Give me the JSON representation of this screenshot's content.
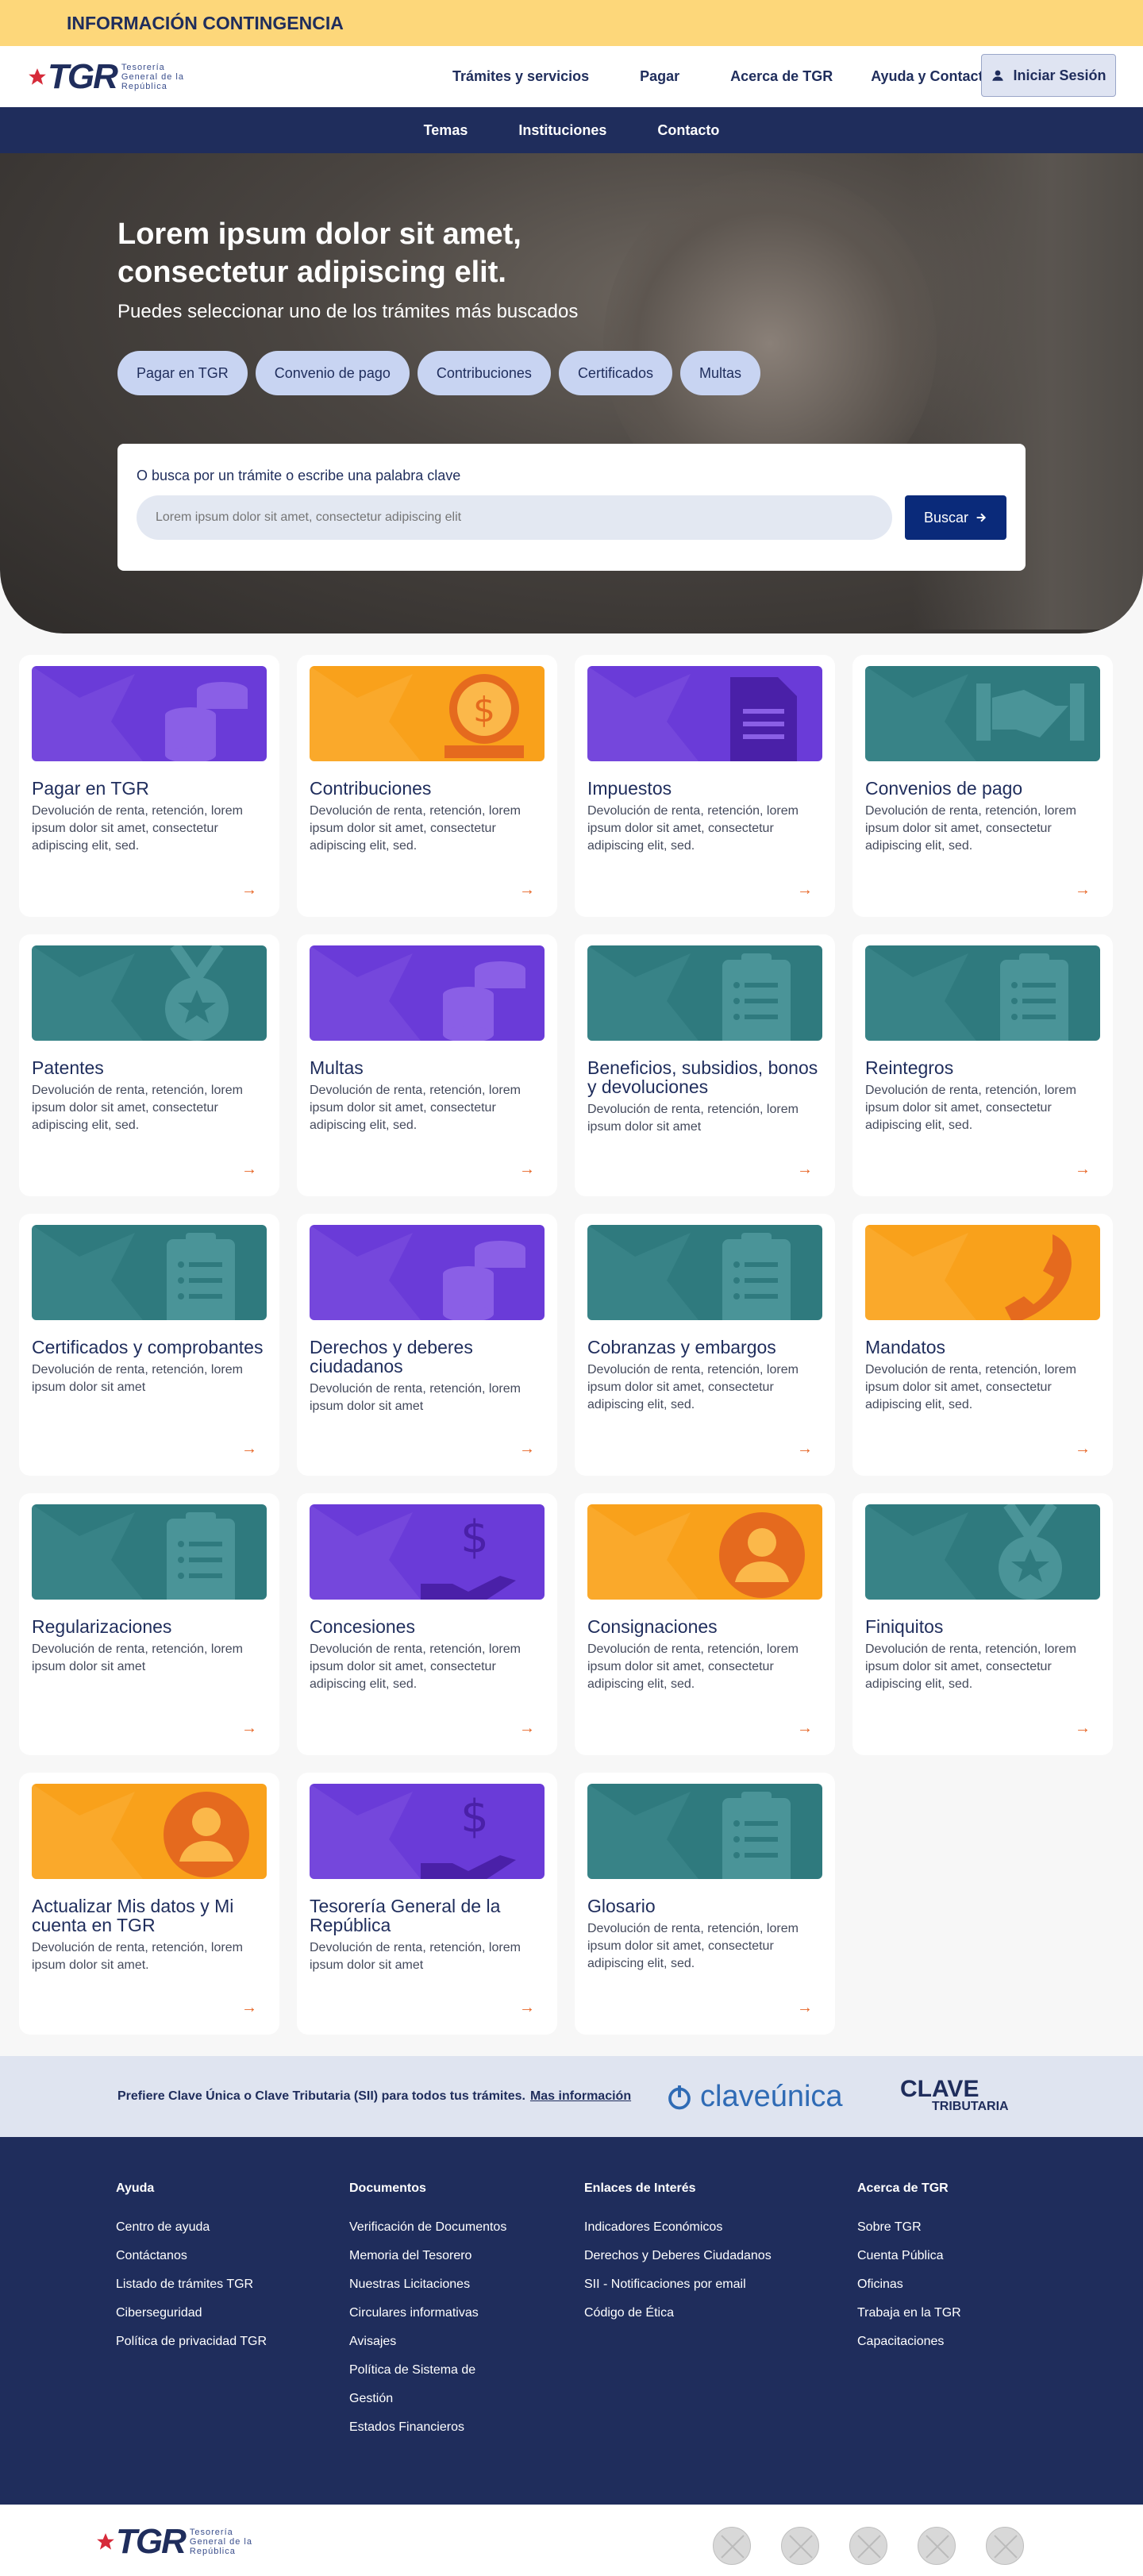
{
  "banner": {
    "text": "INFORMACIÓN CONTINGENCIA"
  },
  "header": {
    "logo_text": "TGR",
    "logo_sub": [
      "Tesorería",
      "General de la",
      "República"
    ],
    "nav": [
      "Trámites y servicios",
      "Pagar",
      "Acerca de TGR",
      "Ayuda y Contacto"
    ],
    "login_label": "Iniciar Sesión"
  },
  "subnav": [
    "Temas",
    "Instituciones",
    "Contacto"
  ],
  "hero": {
    "title": "Lorem ipsum dolor sit amet, consectetur adipiscing elit.",
    "subtitle": "Puedes seleccionar uno de los trámites más buscados",
    "chips": [
      "Pagar en TGR",
      "Convenio de pago",
      "Contribuciones",
      "Certificados",
      "Multas"
    ],
    "search_label": "O busca por un trámite o escribe una  palabra clave",
    "search_placeholder": "Lorem ipsum dolor sit amet, consectetur adipiscing elit",
    "search_button": "Buscar"
  },
  "cards": [
    {
      "title": "Pagar en TGR",
      "desc": "Devolución de renta, retención, lorem ipsum dolor sit amet, consectetur adipiscing elit, sed.",
      "color": "#6a3bd8",
      "icon": "coins-icon"
    },
    {
      "title": "Contribuciones",
      "desc": "Devolución de renta, retención, lorem ipsum dolor sit amet, consectetur adipiscing elit, sed.",
      "color": "#f9a11b",
      "icon": "dollar-coin-icon"
    },
    {
      "title": "Impuestos",
      "desc": "Devolución de renta, retención, lorem ipsum dolor sit amet, consectetur adipiscing elit, sed.",
      "color": "#6a3bd8",
      "icon": "document-icon"
    },
    {
      "title": "Convenios de pago",
      "desc": "Devolución de renta, retención, lorem ipsum dolor sit amet, consectetur adipiscing elit, sed.",
      "color": "#2f7a7e",
      "icon": "handshake-icon"
    },
    {
      "title": "Patentes",
      "desc": "Devolución de renta, retención, lorem ipsum dolor sit amet, consectetur adipiscing elit, sed.",
      "color": "#2f7a7e",
      "icon": "medal-icon"
    },
    {
      "title": "Multas",
      "desc": "Devolución de renta, retención, lorem ipsum dolor sit amet, consectetur adipiscing elit, sed.",
      "color": "#6a3bd8",
      "icon": "coins-icon"
    },
    {
      "title": "Beneficios, subsidios, bonos y devoluciones",
      "desc": "Devolución de renta, retención, lorem ipsum dolor sit amet",
      "color": "#2f7a7e",
      "icon": "clipboard-icon"
    },
    {
      "title": "Reintegros",
      "desc": "Devolución de renta, retención, lorem ipsum dolor sit amet, consectetur adipiscing elit, sed.",
      "color": "#2f7a7e",
      "icon": "clipboard-icon"
    },
    {
      "title": "Certificados y comprobantes",
      "desc": "Devolución de renta, retención, lorem ipsum dolor sit amet",
      "color": "#2f7a7e",
      "icon": "clipboard-icon"
    },
    {
      "title": "Derechos y deberes ciudadanos",
      "desc": "Devolución de renta, retención, lorem ipsum dolor sit amet",
      "color": "#6a3bd8",
      "icon": "coins-icon"
    },
    {
      "title": "Cobranzas y embargos",
      "desc": "Devolución de renta, retención, lorem ipsum dolor sit amet, consectetur adipiscing elit, sed.",
      "color": "#2f7a7e",
      "icon": "clipboard-icon"
    },
    {
      "title": "Mandatos",
      "desc": "Devolución de renta, retención, lorem ipsum dolor sit amet, consectetur adipiscing elit, sed.",
      "color": "#f9a11b",
      "icon": "phone-icon"
    },
    {
      "title": "Regularizaciones",
      "desc": "Devolución de renta, retención, lorem ipsum dolor sit amet",
      "color": "#2f7a7e",
      "icon": "clipboard-icon"
    },
    {
      "title": "Concesiones",
      "desc": "Devolución de renta, retención, lorem ipsum dolor sit amet, consectetur adipiscing elit, sed.",
      "color": "#6a3bd8",
      "icon": "hand-dollar-icon"
    },
    {
      "title": "Consignaciones",
      "desc": "Devolución de renta, retención, lorem ipsum dolor sit amet, consectetur adipiscing elit, sed.",
      "color": "#f9a11b",
      "icon": "user-icon"
    },
    {
      "title": "Finiquitos",
      "desc": "Devolución de renta, retención, lorem ipsum dolor sit amet, consectetur adipiscing elit, sed.",
      "color": "#2f7a7e",
      "icon": "medal-icon"
    },
    {
      "title": "Actualizar Mis datos y Mi cuenta en TGR",
      "desc": "Devolución de renta, retención, lorem ipsum dolor sit amet.",
      "color": "#f9a11b",
      "icon": "user-icon"
    },
    {
      "title": "Tesorería General de la República",
      "desc": "Devolución de renta, retención, lorem ipsum dolor sit amet",
      "color": "#6a3bd8",
      "icon": "hand-dollar-icon"
    },
    {
      "title": "Glosario",
      "desc": "Devolución de renta, retención, lorem ipsum dolor sit amet, consectetur adipiscing elit, sed.",
      "color": "#2f7a7e",
      "icon": "clipboard-icon"
    }
  ],
  "clave": {
    "text": "Prefiere Clave Única o Clave Tributaria (SII) para todos tus trámites.",
    "link": "Mas información",
    "unica_logo": "claveúnica",
    "trib_logo_1": "CLAVE",
    "trib_logo_2": "TRIBUTARIA"
  },
  "footer": {
    "columns": [
      {
        "title": "Ayuda",
        "items": [
          "Centro de ayuda",
          "Contáctanos",
          "Listado de trámites TGR",
          "Ciberseguridad",
          "Política de privacidad TGR"
        ]
      },
      {
        "title": "Documentos",
        "items": [
          "Verificación de Documentos",
          "Memoria del Tesorero",
          "Nuestras Licitaciones",
          "Circulares informativas",
          "Avisajes",
          "Política de Sistema de",
          "Gestión",
          "Estados Financieros"
        ]
      },
      {
        "title": "Enlaces de Interés",
        "items": [
          "Indicadores Económicos",
          "Derechos y Deberes Ciudadanos",
          "SII - Notificaciones por email",
          "Código de Ética"
        ]
      },
      {
        "title": "Acerca de TGR",
        "items": [
          "Sobre TGR",
          "Cuenta Pública",
          "Oficinas",
          "Trabaja en la TGR",
          "Capacitaciones"
        ]
      }
    ]
  }
}
